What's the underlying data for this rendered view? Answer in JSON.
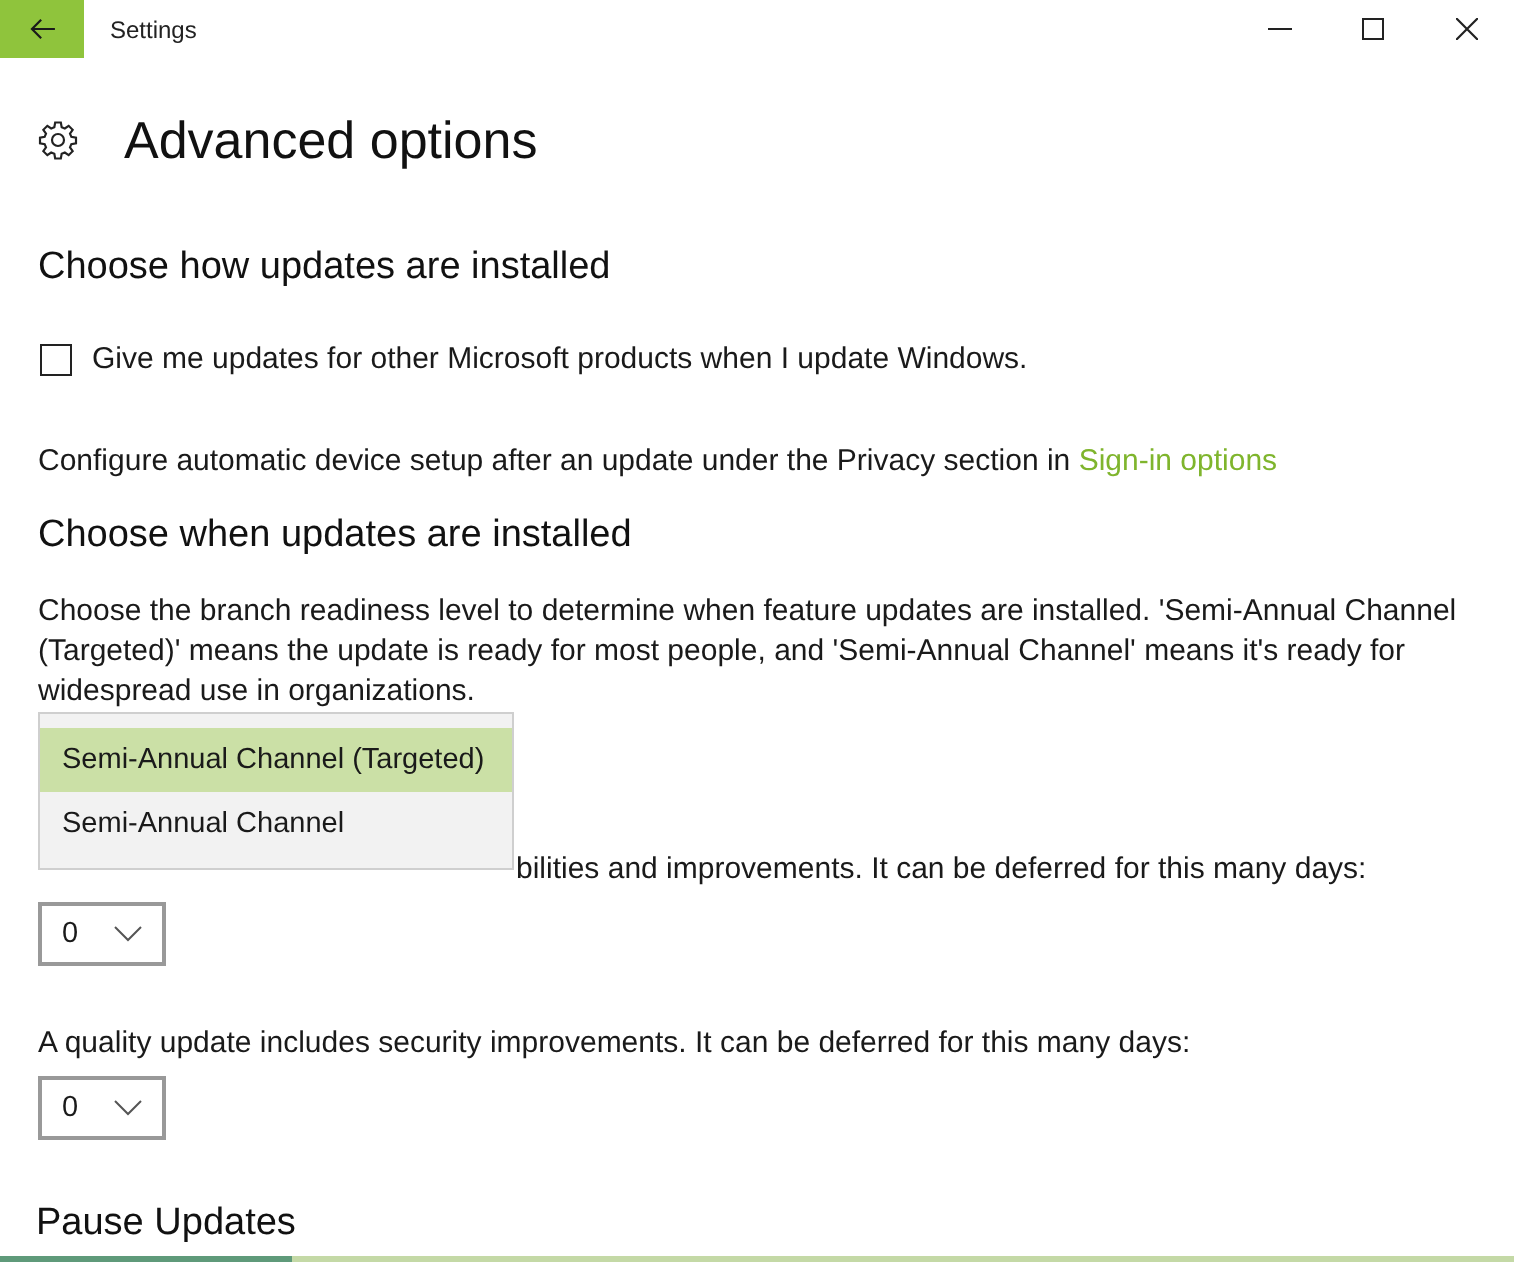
{
  "window": {
    "title": "Settings"
  },
  "page": {
    "title": "Advanced options"
  },
  "install_section": {
    "heading": "Choose how updates are installed",
    "checkbox": {
      "label": "Give me updates for other Microsoft products when I update Windows.",
      "checked": false
    },
    "note": {
      "text": "Configure automatic device setup after an update under the Privacy section in",
      "link": "Sign-in options"
    }
  },
  "timing_section": {
    "heading": "Choose when updates are installed",
    "description": "Choose the branch readiness level to determine when feature updates are installed. 'Semi-Annual Channel (Targeted)' means the update is ready for most people, and 'Semi-Annual Channel' means it's ready for widespread use in organizations.",
    "branch_menu": {
      "options": [
        {
          "label": "Semi-Annual Channel (Targeted)",
          "selected": true
        },
        {
          "label": "Semi-Annual Channel",
          "selected": false
        }
      ]
    },
    "feature_deferral": {
      "label": "bilities and improvements. It can be deferred for this many days:",
      "value": "0"
    },
    "quality_deferral": {
      "label": "A quality update includes security improvements. It can be deferred for this many days:",
      "value": "0"
    }
  },
  "pause_section": {
    "heading": "Pause Updates"
  }
}
